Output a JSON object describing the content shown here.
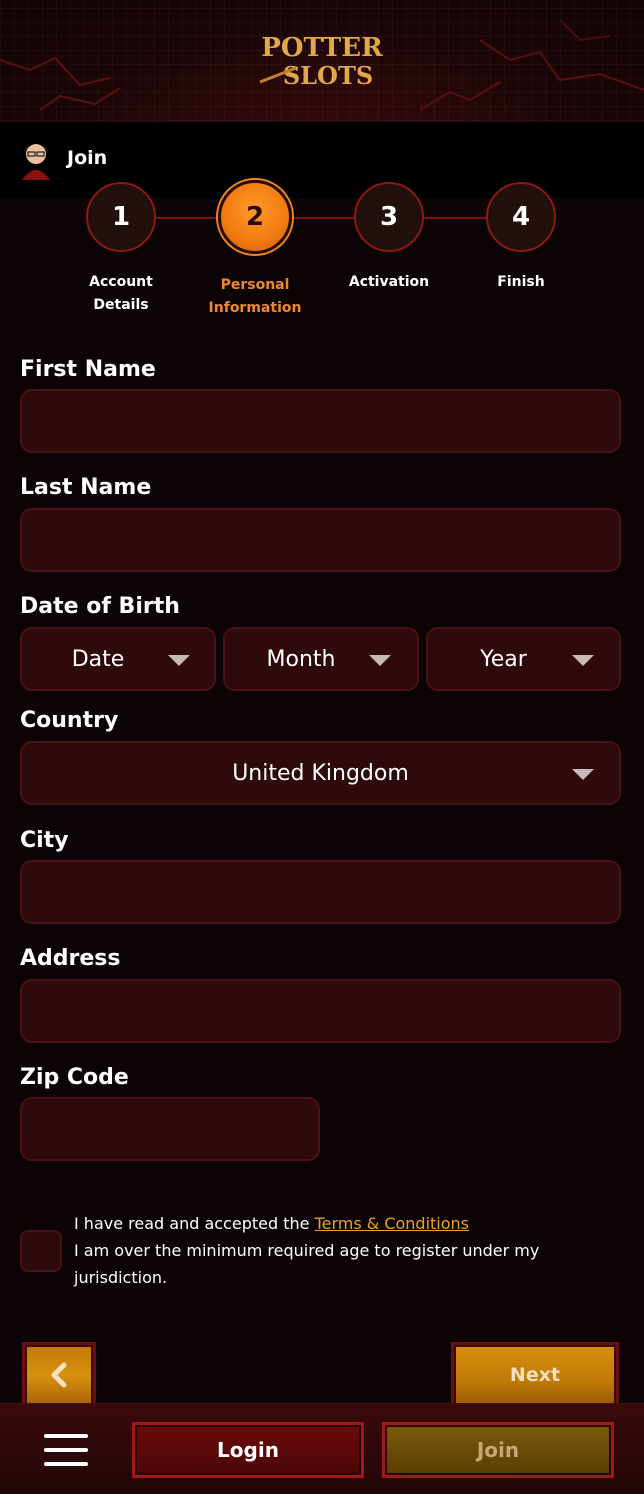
{
  "brand": {
    "logo_line1": "POTTER",
    "logo_line2": "SLOTS"
  },
  "joinbar": {
    "title": "Join"
  },
  "steps": [
    {
      "number": "1",
      "label_line1": "Account",
      "label_line2": "Details",
      "active": false
    },
    {
      "number": "2",
      "label_line1": "Personal",
      "label_line2": "Information",
      "active": true
    },
    {
      "number": "3",
      "label_line1": "Activation",
      "label_line2": "",
      "active": false
    },
    {
      "number": "4",
      "label_line1": "Finish",
      "label_line2": "",
      "active": false
    }
  ],
  "form": {
    "first_name": {
      "label": "First Name",
      "value": "",
      "placeholder": ""
    },
    "last_name": {
      "label": "Last Name",
      "value": "",
      "placeholder": ""
    },
    "dob": {
      "label": "Date of Birth",
      "date": "Date",
      "month": "Month",
      "year": "Year"
    },
    "country": {
      "label": "Country",
      "value": "United Kingdom"
    },
    "city": {
      "label": "City",
      "value": "",
      "placeholder": ""
    },
    "address": {
      "label": "Address",
      "value": "",
      "placeholder": ""
    },
    "zip": {
      "label": "Zip Code",
      "value": "",
      "placeholder": ""
    },
    "terms": {
      "text_before": "I have read and accepted the ",
      "link": "Terms & Conditions",
      "line2": "I am over the minimum required age to register under my jurisdiction.",
      "checked": false
    }
  },
  "nav": {
    "next_label": "Next"
  },
  "bottom_bar": {
    "login_label": "Login",
    "join_label": "Join"
  },
  "colors": {
    "accent": "#f08820",
    "field_bg": "#2e0a0d",
    "bg": "#0c0405"
  }
}
